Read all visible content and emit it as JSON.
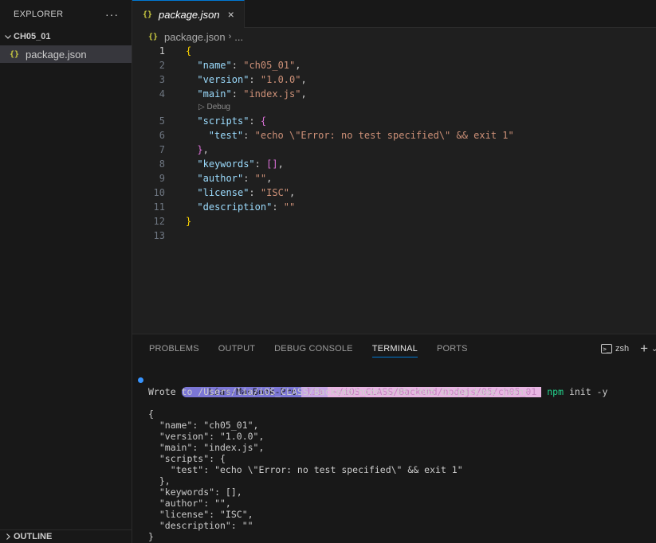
{
  "sidebar": {
    "title": "EXPLORER",
    "more": "···",
    "folder": "CH05_01",
    "file": "package.json",
    "file_icon": "{}",
    "outline": "OUTLINE"
  },
  "tab": {
    "icon": "{}",
    "title": "package.json",
    "close": "×"
  },
  "breadcrumb": {
    "file": "package.json",
    "rest": "..."
  },
  "codelens": "Debug",
  "code_lines": [
    {
      "n": "1",
      "t": "{"
    },
    {
      "n": "2",
      "t": "\"name\": \"ch05_01\","
    },
    {
      "n": "3",
      "t": "\"version\": \"1.0.0\","
    },
    {
      "n": "4",
      "t": "\"main\": \"index.js\","
    },
    {
      "n": "5",
      "t": "\"scripts\": {"
    },
    {
      "n": "6",
      "t": "\"test\": \"echo \\\"Error: no test specified\\\" && exit 1\""
    },
    {
      "n": "7",
      "t": "},"
    },
    {
      "n": "8",
      "t": "\"keywords\": [],"
    },
    {
      "n": "9",
      "t": "\"author\": \"\","
    },
    {
      "n": "10",
      "t": "\"license\": \"ISC\","
    },
    {
      "n": "11",
      "t": "\"description\": \"\""
    },
    {
      "n": "12",
      "t": "}"
    },
    {
      "n": "13",
      "t": ""
    }
  ],
  "panel": {
    "tabs": [
      "PROBLEMS",
      "OUTPUT",
      "DEBUG CONSOLE",
      "TERMINAL",
      "PORTS"
    ],
    "active_tab": "TERMINAL",
    "shell": "zsh"
  },
  "terminal": {
    "host": "Lias-MacBook-Pro",
    "user": "lia",
    "dir": "~/iOS_CLASS/Backend/nodejs/05/ch05_01",
    "command": "npm",
    "args": " init -y",
    "output": [
      "Wrote to /Users/lia/iOS_CLASS/Backend/nodejs/05/ch05_01/package.json:",
      "",
      "{",
      "  \"name\": \"ch05_01\",",
      "  \"version\": \"1.0.0\",",
      "  \"main\": \"index.js\",",
      "  \"scripts\": {",
      "    \"test\": \"echo \\\"Error: no test specified\\\" && exit 1\"",
      "  },",
      "  \"keywords\": [],",
      "  \"author\": \"\",",
      "  \"license\": \"ISC\",",
      "  \"description\": \"\"",
      "}"
    ]
  },
  "colors": {
    "accent": "#0078d4",
    "json_icon": "#cbcb41",
    "string": "#ce9178",
    "key": "#9cdcfe",
    "command": "#23d18b"
  }
}
